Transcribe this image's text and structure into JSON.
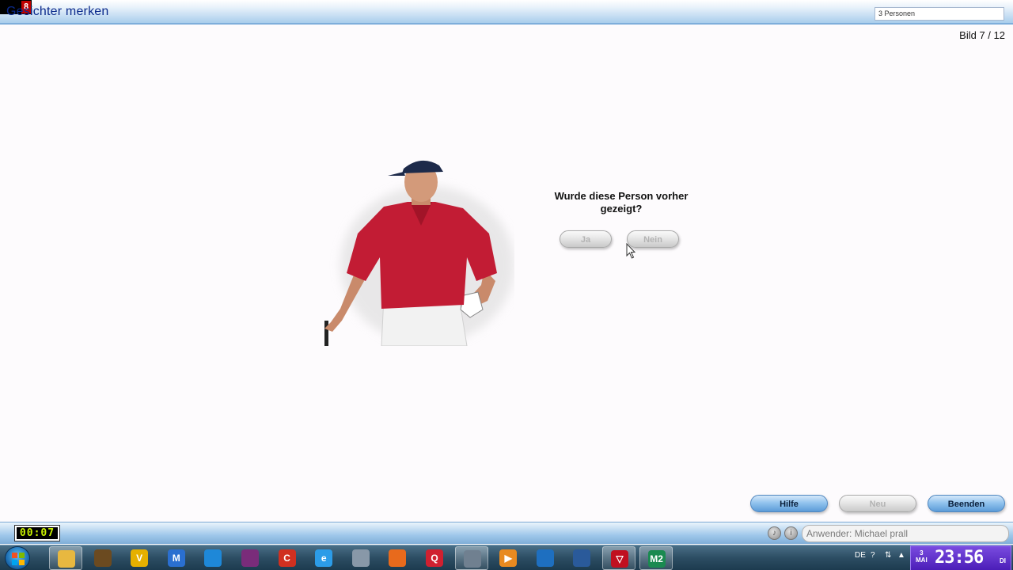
{
  "window": {
    "title": "Gesichter merken",
    "badge_digit": "8",
    "dropdown_value": "3 Personen"
  },
  "counter": "Bild 7 / 12",
  "question": "Wurde diese Person vorher gezeigt?",
  "answers": {
    "yes": "Ja",
    "no": "Nein"
  },
  "actions": {
    "help": "Hilfe",
    "new": "Neu",
    "quit": "Beenden"
  },
  "status": {
    "timer": "00:07",
    "user": "Anwender: Michael prall"
  },
  "taskbar": {
    "tray_lang": "DE",
    "clock_time": "23:56",
    "clock_day_num": "3",
    "clock_month": "MAI",
    "clock_weekday": "DI",
    "items": [
      {
        "name": "explorer-icon",
        "color": "#e8b840",
        "glyph": ""
      },
      {
        "name": "game-icon",
        "color": "#6b4a20",
        "glyph": ""
      },
      {
        "name": "v-app-icon",
        "color": "#e6b000",
        "glyph": "V"
      },
      {
        "name": "malwarebytes-icon",
        "color": "#2a6fd0",
        "glyph": "M"
      },
      {
        "name": "remote-desktop-icon",
        "color": "#1e88d8",
        "glyph": ""
      },
      {
        "name": "winrar-icon",
        "color": "#7a2c7a",
        "glyph": ""
      },
      {
        "name": "ccleaner-icon",
        "color": "#d03020",
        "glyph": "C"
      },
      {
        "name": "internet-explorer-icon",
        "color": "#2c9ce8",
        "glyph": "e"
      },
      {
        "name": "files-icon",
        "color": "#8898a8",
        "glyph": ""
      },
      {
        "name": "firefox-icon",
        "color": "#e86a1c",
        "glyph": ""
      },
      {
        "name": "q-app-icon",
        "color": "#d02030",
        "glyph": "Q"
      },
      {
        "name": "monitor-app-icon",
        "color": "#708090",
        "glyph": ""
      },
      {
        "name": "media-player-icon",
        "color": "#e88a20",
        "glyph": "▶"
      },
      {
        "name": "swirl-app-icon",
        "color": "#1e6fc0",
        "glyph": ""
      },
      {
        "name": "thunderbird-icon",
        "color": "#2a5a9a",
        "glyph": ""
      },
      {
        "name": "shield-app-icon",
        "color": "#c01020",
        "glyph": "▽"
      },
      {
        "name": "fm2-icon",
        "color": "#1a8a50",
        "glyph": "M2"
      }
    ]
  }
}
